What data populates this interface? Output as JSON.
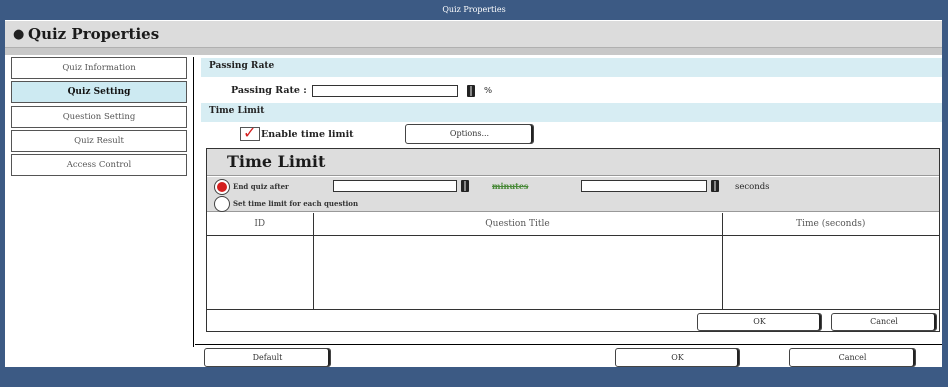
{
  "window": {
    "title": "Quiz Properties"
  },
  "header": {
    "title": "Quiz Properties"
  },
  "sidebar": {
    "items": [
      {
        "label": "Quiz Information"
      },
      {
        "label": "Quiz Setting"
      },
      {
        "label": "Question Setting"
      },
      {
        "label": "Quiz Result"
      },
      {
        "label": "Access Control"
      }
    ],
    "active_index": 1
  },
  "passing_rate": {
    "section_title": "Passing Rate",
    "field_label": "Passing Rate :",
    "value": "",
    "unit": "%"
  },
  "time_limit": {
    "section_title": "Time Limit",
    "enable_label": "Enable time limit",
    "enabled": true,
    "options_button": "Options...",
    "panel_title": "Time Limit",
    "end_quiz_label": "End quiz after",
    "end_quiz_selected": true,
    "minutes_value": "",
    "minutes_label": "minutes",
    "seconds_value": "",
    "seconds_label": "seconds",
    "per_question_label": "Set time limit for each question",
    "per_question_selected": false,
    "table": {
      "columns": [
        "ID",
        "Question Title",
        "Time (seconds)"
      ],
      "rows": []
    },
    "ok_button": "OK",
    "cancel_button": "Cancel"
  },
  "footer": {
    "default_button": "Default",
    "ok_button": "OK",
    "cancel_button": "Cancel"
  },
  "colors": {
    "titlebar": "#3c5a84",
    "active_tab": "#cdeaf2",
    "section_bar": "#d7edf3",
    "check_accent": "#d42020",
    "minutes_text": "#4a8a3a"
  },
  "icons": {
    "header_bullet": "bullet-icon",
    "checkbox_mark": "check-icon",
    "radio_selected": "radio-selected-icon"
  }
}
